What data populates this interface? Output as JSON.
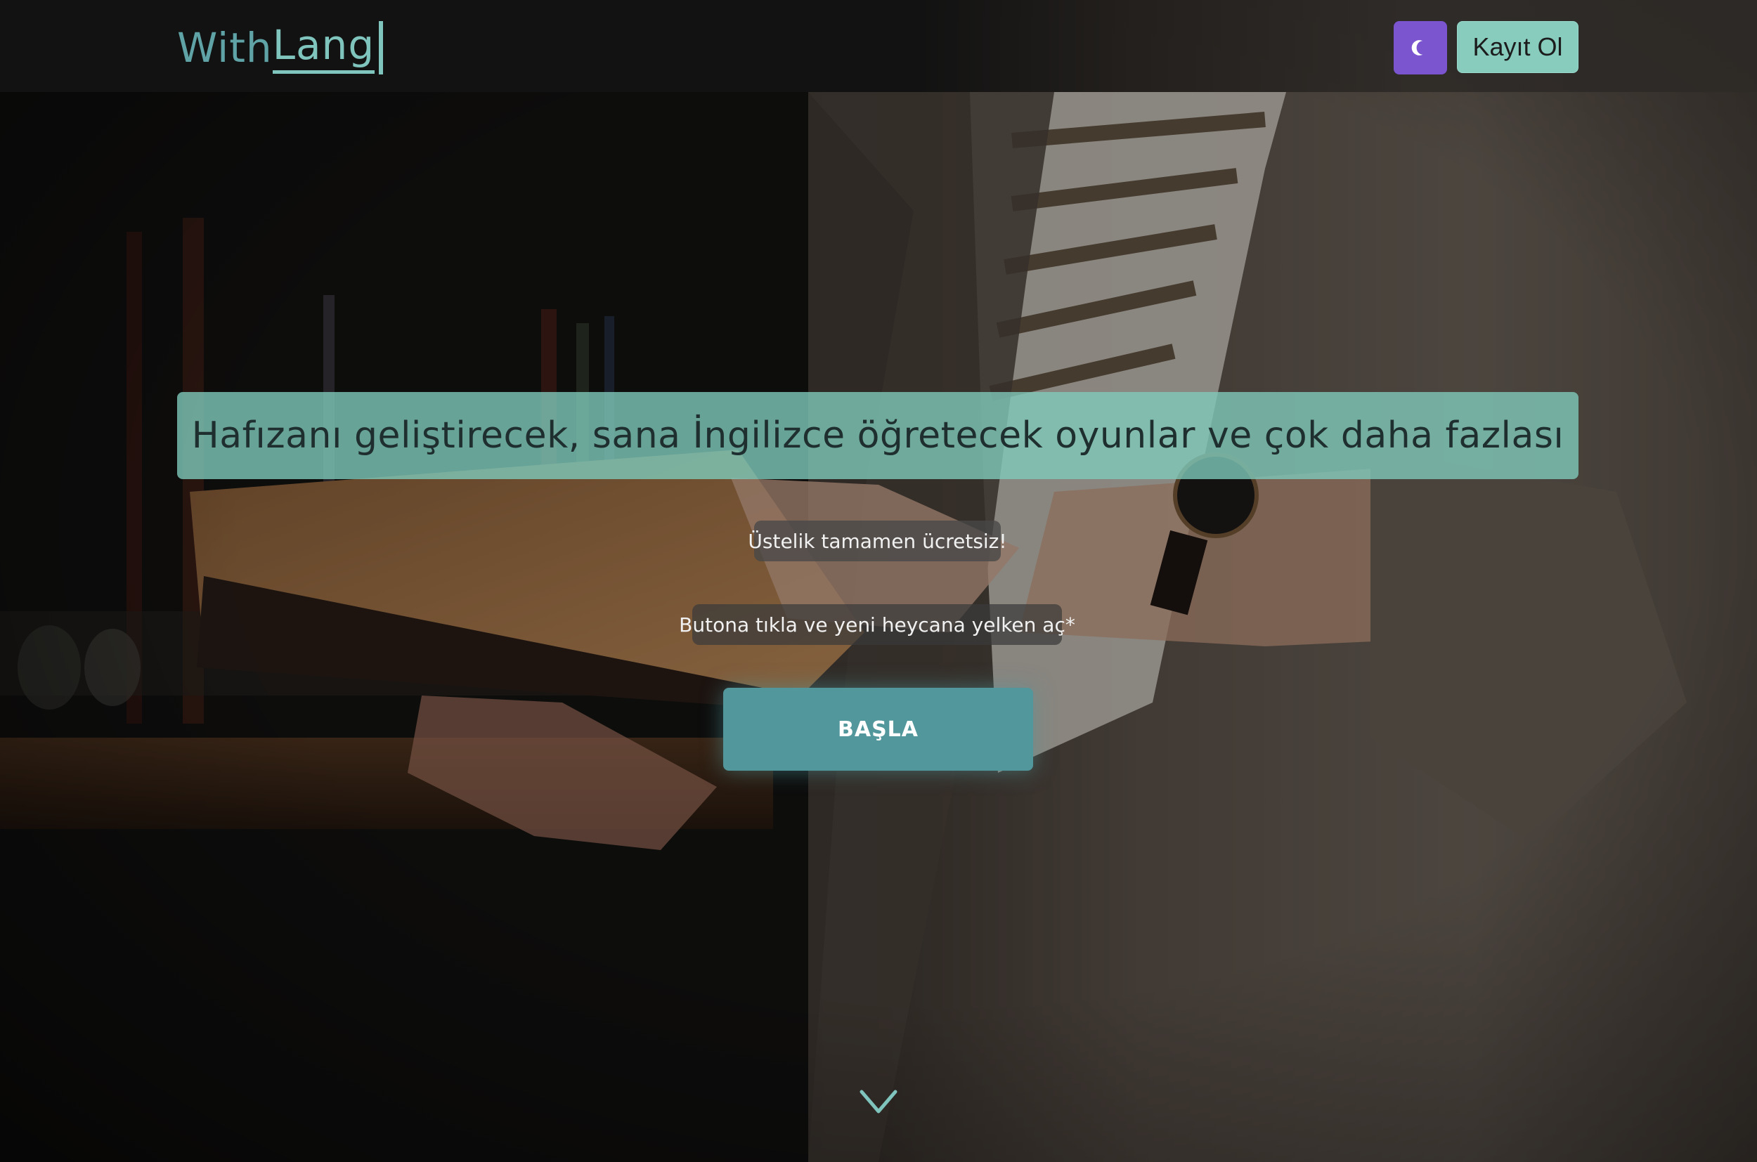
{
  "header": {
    "logo_part1": "With",
    "logo_part2": "Lang",
    "theme_toggle_icon": "moon-icon",
    "signup_label": "Kayıt Ol"
  },
  "hero": {
    "headline": "Hafızanı geliştirecek, sana İngilizce öğretecek oyunlar ve çok daha fazlası",
    "free_note": "Üstelik tamamen ücretsiz!",
    "cta_note": "Butona tıkla ve yeni heycana yelken aç*",
    "start_label": "BAŞLA",
    "scroll_icon": "chevron-down-icon"
  },
  "colors": {
    "accent_teal": "#52979c",
    "mint": "#87ccbd",
    "theme_toggle": "#7a55cf",
    "background": "#131313"
  }
}
